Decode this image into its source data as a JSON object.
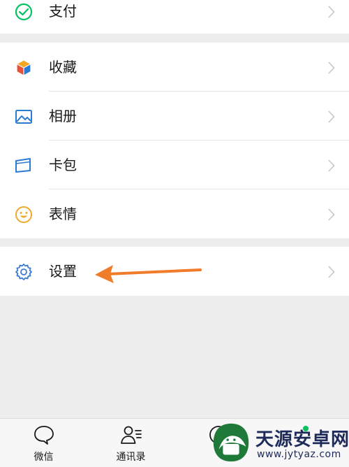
{
  "menu": {
    "pay_label": "支付",
    "favorites_label": "收藏",
    "album_label": "相册",
    "cards_label": "卡包",
    "stickers_label": "表情",
    "settings_label": "设置"
  },
  "tabbar": {
    "chats_label": "微信",
    "contacts_label": "通讯录"
  },
  "watermark": {
    "name": "天源安卓网",
    "url": "www.jytyaz.com"
  },
  "colors": {
    "pay_icon": "#07c160",
    "favorites_icon": "#f5a623",
    "album_icon": "#2b7bd6",
    "stickers_icon": "#f0a92a",
    "settings_icon": "#3a7bd5",
    "arrow": "#f07c2a",
    "background": "#ededed"
  }
}
